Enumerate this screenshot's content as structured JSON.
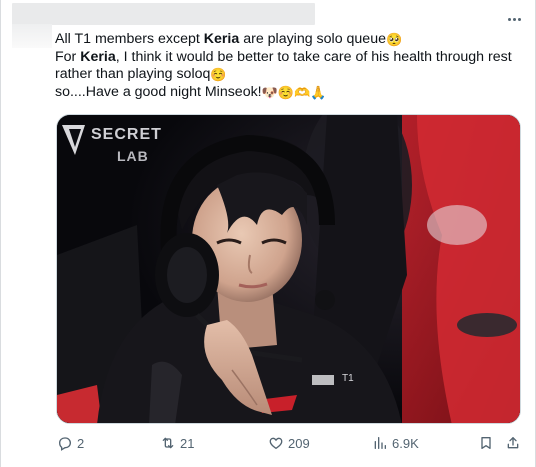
{
  "tweet": {
    "line1_pre": "All T1 members except ",
    "line1_bold": "Keria",
    "line1_post": " are playing solo queue",
    "line1_emoji": "🥺",
    "line2_pre": "For ",
    "line2_bold": "Keria",
    "line2_post": ", I think it would be better to take care of his health through rest",
    "line3_text": "rather than playing soloq",
    "line3_emoji": "☺️",
    "line4_text": "so....Have a good night Minseok!",
    "line4_emojis": "🐶☺️🫶🙏"
  },
  "media": {
    "sign_line1": "SECRET",
    "sign_line2": "LAB",
    "jersey_text": "T1"
  },
  "actions": {
    "replies": "2",
    "reposts": "21",
    "likes": "209",
    "views": "6.9K"
  },
  "colors": {
    "accent_blue": "#1d9bf0",
    "icon_gray": "#536471",
    "text": "#0f1419"
  },
  "icons": {
    "reply": "speech-bubble-icon",
    "repost": "repost-arrows-icon",
    "like": "heart-icon",
    "views": "bar-chart-icon",
    "bookmark": "bookmark-icon",
    "share": "share-upload-icon",
    "more": "more-dots-icon"
  }
}
